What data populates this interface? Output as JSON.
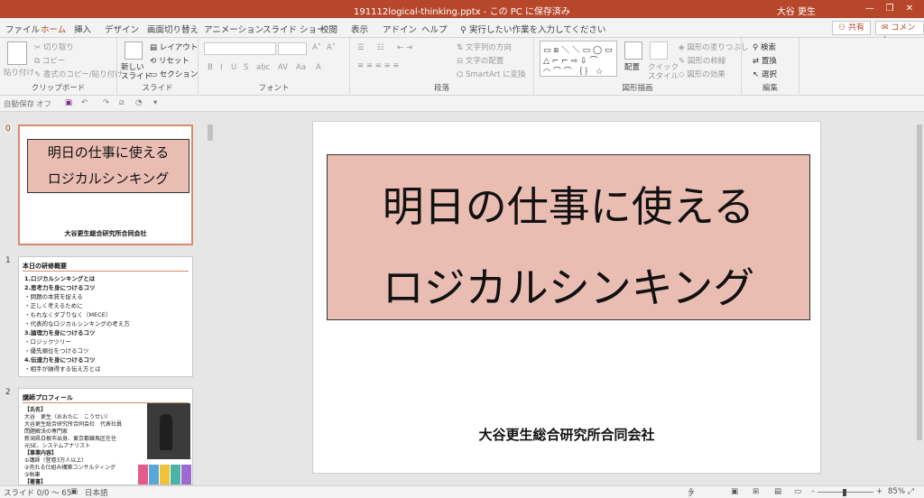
{
  "titlebar": {
    "title": "191112logical-thinking.pptx  -  この PC に保存済み",
    "user": "大谷 更生",
    "minimize": "—",
    "restore": "❐",
    "close": "✕"
  },
  "menu": {
    "tabs": [
      "ファイル",
      "ホーム",
      "挿入",
      "デザイン",
      "画面切り替え",
      "アニメーション",
      "スライド ショー",
      "校閲",
      "表示",
      "アドイン",
      "ヘルプ"
    ],
    "active": "ホーム",
    "search_icon": "lightbulb-icon",
    "search": "実行したい作業を入力してください",
    "share": "共有",
    "comment": "コメント"
  },
  "ribbon": {
    "clipboard": {
      "paste": "貼り付け",
      "cut": "切り取り",
      "copy": "コピー",
      "format_painter": "書式のコピー/貼り付け",
      "label": "クリップボード"
    },
    "slides": {
      "new_slide": "新しい",
      "new_slide2": "スライド",
      "layout": "レイアウト",
      "reset": "リセット",
      "section": "セクション",
      "label": "スライド"
    },
    "font": {
      "label": "フォント",
      "bold": "B",
      "italic": "I",
      "underline": "U",
      "strike": "S",
      "shadow": "abc",
      "spacing": "AV",
      "case": "Aa",
      "color": "A"
    },
    "paragraph": {
      "text_direction": "文字列の方向",
      "align_text": "文字の配置",
      "smartart": "SmartArt に変換",
      "label": "段落"
    },
    "drawing": {
      "arrange": "配置",
      "quick_styles": "クイック",
      "quick_styles2": "スタイル",
      "fill": "図形の塗りつぶし",
      "outline": "図形の枠線",
      "effects": "図形の効果",
      "label": "図形描画"
    },
    "editing": {
      "find": "検索",
      "replace": "置換",
      "select": "選択",
      "label": "編集"
    }
  },
  "qat": {
    "autosave": "自動保存",
    "toggle": "オフ"
  },
  "thumbnails": [
    {
      "num": "0",
      "title_l1": "明日の仕事に使える",
      "title_l2": "ロジカルシンキング",
      "org": "大谷更生総合研究所合同会社"
    },
    {
      "num": "1",
      "heading": "本日の研修概要",
      "lines": [
        "1.ロジカルシンキングとは",
        "2.思考力を身につけるコツ",
        "・問題の本質を捉える",
        "・正しく考えるために",
        "・もれなくダブりなく（MECE）",
        "・代表的なロジカルシンキングの考え方",
        "3.論理力を身につけるコツ",
        "・ロジックツリー",
        "・優先順位をつけるコツ",
        "4.伝達力を身につけるコツ",
        "・相手が納得する伝え方とは"
      ]
    },
    {
      "num": "2",
      "heading": "講師プロフィール",
      "lines": [
        "【氏名】",
        "大谷　更生（おおたに　こうせい）",
        "大谷更生総合研究所合同会社　代表社員",
        "問題解決の専門家",
        "新潟県白根市出身、東京都練馬区在住",
        "元SE、システムアナリスト",
        "【事業内容】",
        "①講師（登壇3万人以上）",
        "②売れる仕組み構築コンサルティング",
        "③執筆",
        "【著書】"
      ]
    }
  ],
  "slide": {
    "title_l1": "明日の仕事に使える",
    "title_l2": "ロジカルシンキング",
    "org": "大谷更生総合研究所合同会社"
  },
  "status": {
    "slide_info": "スライド 0/0 ～ 65",
    "language": "日本語",
    "notes": "ノート",
    "zoom": "85%"
  },
  "colors": {
    "accent": "#b7472a",
    "title_fill": "#eabdb3"
  }
}
